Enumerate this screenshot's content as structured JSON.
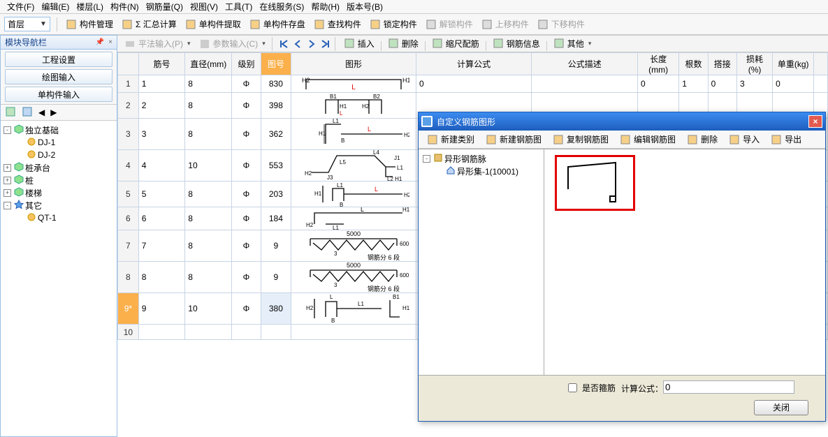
{
  "menu": [
    "文件(F)",
    "编辑(E)",
    "楼层(L)",
    "构件(N)",
    "钢筋量(Q)",
    "视图(V)",
    "工具(T)",
    "在线服务(S)",
    "帮助(H)",
    "版本号(B)"
  ],
  "toolbar": {
    "floor_selected": "首层",
    "items": [
      {
        "label": "构件管理",
        "disabled": false
      },
      {
        "label": "Σ 汇总计算",
        "disabled": false
      },
      {
        "label": "单构件提取",
        "disabled": false
      },
      {
        "label": "单构件存盘",
        "disabled": false
      },
      {
        "label": "查找构件",
        "disabled": false
      },
      {
        "label": "锁定构件",
        "disabled": false
      },
      {
        "label": "解锁构件",
        "disabled": true
      },
      {
        "label": "上移构件",
        "disabled": true
      },
      {
        "label": "下移构件",
        "disabled": true
      }
    ]
  },
  "left": {
    "panel_title": "模块导航栏",
    "modules": [
      "工程设置",
      "绘图输入",
      "单构件输入"
    ],
    "tree": [
      {
        "exp": "-",
        "depth": 0,
        "icon": "cube",
        "label": "独立基础"
      },
      {
        "exp": "",
        "depth": 1,
        "icon": "gear",
        "label": "DJ-1"
      },
      {
        "exp": "",
        "depth": 1,
        "icon": "gear",
        "label": "DJ-2"
      },
      {
        "exp": "+",
        "depth": 0,
        "icon": "cube",
        "label": "桩承台"
      },
      {
        "exp": "+",
        "depth": 0,
        "icon": "cube",
        "label": "桩"
      },
      {
        "exp": "+",
        "depth": 0,
        "icon": "cube",
        "label": "楼梯"
      },
      {
        "exp": "-",
        "depth": 0,
        "icon": "star",
        "label": "其它"
      },
      {
        "exp": "",
        "depth": 1,
        "icon": "gear",
        "label": "QT-1"
      }
    ]
  },
  "grid_toolbar": {
    "items": [
      {
        "label": "平法输入(P)",
        "disabled": true
      },
      {
        "label": "参数输入(C)",
        "disabled": true
      }
    ],
    "actions": [
      {
        "label": "插入"
      },
      {
        "label": "删除"
      },
      {
        "label": "缩尺配筋"
      },
      {
        "label": "钢筋信息"
      },
      {
        "label": "其他"
      }
    ]
  },
  "grid": {
    "headers": [
      "",
      "筋号",
      "直径(mm)",
      "级别",
      "图号",
      "图形",
      "计算公式",
      "公式描述",
      "长度(mm)",
      "根数",
      "搭接",
      "损耗(%)",
      "单重(kg)",
      ""
    ],
    "widths": [
      30,
      68,
      68,
      42,
      44,
      184,
      170,
      156,
      60,
      42,
      42,
      52,
      60,
      20
    ],
    "selected_col_idx": 4,
    "rows": [
      {
        "hdr": "1",
        "sel": false,
        "cells": [
          "1",
          "8",
          "Φ",
          "830"
        ],
        "shape": 1,
        "formula": "0",
        "desc": "",
        "vals": [
          "0",
          "1",
          "0",
          "3",
          "0",
          ""
        ]
      },
      {
        "hdr": "2",
        "sel": false,
        "cells": [
          "2",
          "8",
          "Φ",
          "398"
        ],
        "shape": 2,
        "formula": "",
        "desc": "",
        "vals": [
          "",
          "",
          "",
          "",
          "",
          ""
        ]
      },
      {
        "hdr": "3",
        "sel": false,
        "cells": [
          "3",
          "8",
          "Φ",
          "362"
        ],
        "shape": 3,
        "formula": "",
        "desc": "",
        "vals": [
          "",
          "",
          "",
          "",
          "",
          ""
        ]
      },
      {
        "hdr": "4",
        "sel": false,
        "cells": [
          "4",
          "10",
          "Φ",
          "553"
        ],
        "shape": 4,
        "formula": "",
        "desc": "",
        "vals": [
          "",
          "",
          "",
          "",
          "",
          ""
        ]
      },
      {
        "hdr": "5",
        "sel": false,
        "cells": [
          "5",
          "8",
          "Φ",
          "203"
        ],
        "shape": 5,
        "formula": "",
        "desc": "",
        "vals": [
          "",
          "",
          "",
          "",
          "",
          ""
        ]
      },
      {
        "hdr": "6",
        "sel": false,
        "cells": [
          "6",
          "8",
          "Φ",
          "184"
        ],
        "shape": 6,
        "formula": "",
        "desc": "",
        "vals": [
          "",
          "",
          "",
          "",
          "",
          ""
        ]
      },
      {
        "hdr": "7",
        "sel": false,
        "cells": [
          "7",
          "8",
          "Φ",
          "9"
        ],
        "shape": 7,
        "formula": "",
        "desc": "",
        "vals": [
          "",
          "",
          "",
          "",
          "",
          ""
        ]
      },
      {
        "hdr": "8",
        "sel": false,
        "cells": [
          "8",
          "8",
          "Φ",
          "9"
        ],
        "shape": 7,
        "formula": "",
        "desc": "",
        "vals": [
          "",
          "",
          "",
          "",
          "",
          ""
        ]
      },
      {
        "hdr": "9*",
        "sel": true,
        "cells": [
          "9",
          "10",
          "Φ",
          "380"
        ],
        "shape": 9,
        "formula": "",
        "desc": "",
        "vals": [
          "",
          "",
          "",
          "",
          "",
          ""
        ]
      },
      {
        "hdr": "10",
        "sel": false,
        "short": true,
        "cells": [
          "",
          "",
          "",
          ""
        ],
        "shape": 0,
        "formula": "",
        "desc": "",
        "vals": [
          "",
          "",
          "",
          "",
          "",
          ""
        ]
      }
    ]
  },
  "dialog": {
    "title": "自定义钢筋图形",
    "toolbar": [
      {
        "label": "新建类别",
        "icon": "folder"
      },
      {
        "label": "新建钢筋图",
        "icon": "new"
      },
      {
        "label": "复制钢筋图",
        "icon": "copy"
      },
      {
        "label": "编辑钢筋图",
        "icon": "edit"
      },
      {
        "label": "删除",
        "icon": "del"
      },
      {
        "label": "导入",
        "icon": "imp"
      },
      {
        "label": "导出",
        "icon": "exp"
      }
    ],
    "tree": [
      {
        "exp": "-",
        "depth": 0,
        "icon": "book",
        "label": "异形钢筋脉"
      },
      {
        "exp": "",
        "depth": 1,
        "icon": "home",
        "label": "异形集-1(10001)"
      }
    ],
    "checkbox_label": "是否箍筋",
    "formula_label": "计算公式：",
    "formula_value": "0",
    "close_btn": "关闭"
  }
}
